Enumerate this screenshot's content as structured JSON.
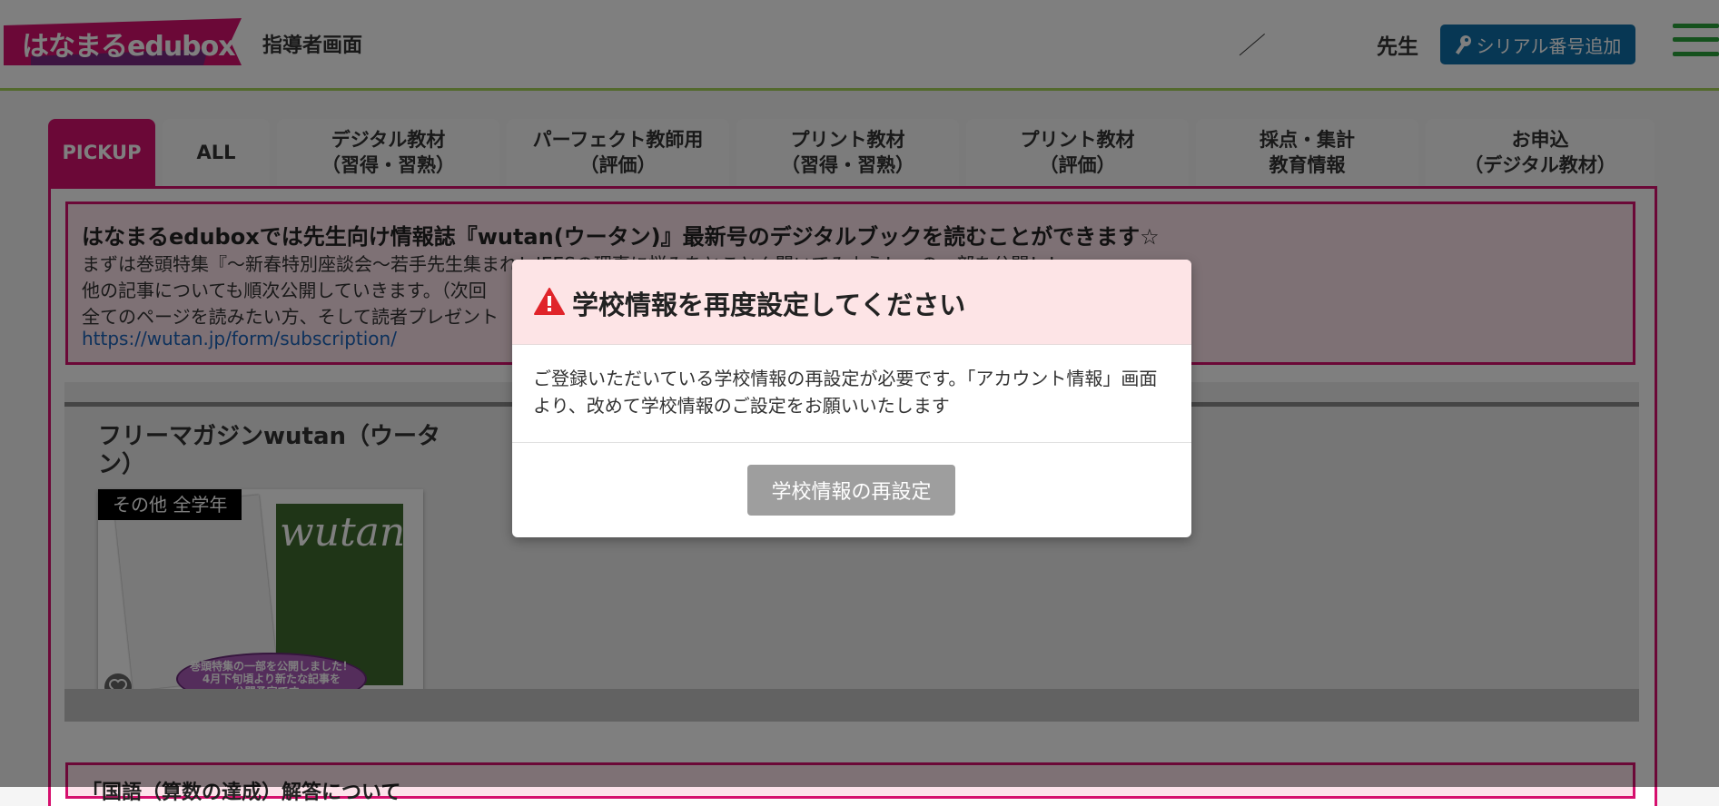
{
  "header": {
    "logo_text": "はなまるedubox",
    "title": "指導者画面",
    "separator": "／",
    "teacher_label": "先生",
    "serial_button_label": "シリアル番号追加"
  },
  "tabs": [
    {
      "line1": "PICKUP",
      "line2": ""
    },
    {
      "line1": "ALL",
      "line2": ""
    },
    {
      "line1": "デジタル教材",
      "line2": "（習得・習熟）"
    },
    {
      "line1": "パーフェクト教師用",
      "line2": "（評価）"
    },
    {
      "line1": "プリント教材",
      "line2": "（習得・習熟）"
    },
    {
      "line1": "プリント教材",
      "line2": "（評価）"
    },
    {
      "line1": "採点・集計",
      "line2": "教育情報"
    },
    {
      "line1": "お申込",
      "line2": "（デジタル教材）"
    }
  ],
  "notice": {
    "title": "はなまるeduboxでは先生向け情報誌『wutan(ウータン)』最新号のデジタルブックを読むことができます☆",
    "line1": "まずは巻頭特集『～新春特別座談会～若手先生集まれ！JEESの理事に悩みをとことん聞いてみよう！』の一部を公開！！",
    "line2": "他の記事についても順次公開していきます。（次回",
    "line3": "全てのページを読みたい方、そして読者プレゼント",
    "link": "https://wutan.jp/form/subscription/"
  },
  "magazine": {
    "title": "フリーマガジンwutan（ウータン）",
    "badge": "その他 全学年",
    "cover_title": "wutan",
    "promo_line1": "巻頭特集の一部を公開しました！",
    "promo_line2": "4月下旬頃より新たな記事を",
    "promo_line3": "公開予定です。"
  },
  "second_notice": {
    "title": "「国語（算数の達成）解答について"
  },
  "modal": {
    "title": "学校情報を再度設定してください",
    "body": "ご登録いただいている学校情報の再設定が必要です。「アカウント情報」画面より、改めて学校情報のご設定をお願いいたします",
    "button_label": "学校情報の再設定"
  },
  "colors": {
    "brand_pink": "#d6106e",
    "header_border": "#a6d35a",
    "serial_button": "#0f6fa8",
    "menu_green": "#2aa23a",
    "modal_header_bg": "#fde4e6",
    "warning_red": "#e0242a"
  }
}
